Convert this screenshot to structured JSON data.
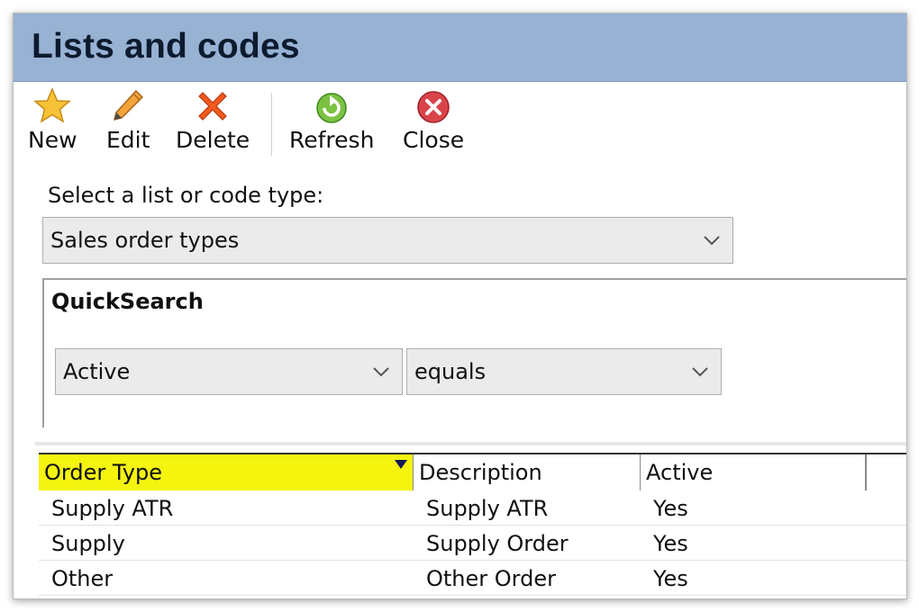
{
  "window": {
    "title": "Lists and codes"
  },
  "toolbar": {
    "buttons": [
      {
        "label": "New",
        "icon": "star-icon"
      },
      {
        "label": "Edit",
        "icon": "pencil-icon"
      },
      {
        "label": "Delete",
        "icon": "red-x-icon"
      },
      {
        "label": "Refresh",
        "icon": "green-refresh-icon"
      },
      {
        "label": "Close",
        "icon": "red-close-circle-icon"
      }
    ]
  },
  "list_type": {
    "label": "Select a list or code type:",
    "selected": "Sales order types"
  },
  "quicksearch": {
    "title": "QuickSearch",
    "field": "Active",
    "operator": "equals"
  },
  "grid": {
    "columns": [
      "Order Type",
      "Description",
      "Active"
    ],
    "rows": [
      [
        "Supply ATR",
        "Supply ATR",
        "Yes"
      ],
      [
        "Supply",
        "Supply Order",
        "Yes"
      ],
      [
        "Other",
        "Other Order",
        "Yes"
      ]
    ]
  },
  "colors": {
    "titlebar": "#98b2d4",
    "highlight": "#f4f40f"
  }
}
